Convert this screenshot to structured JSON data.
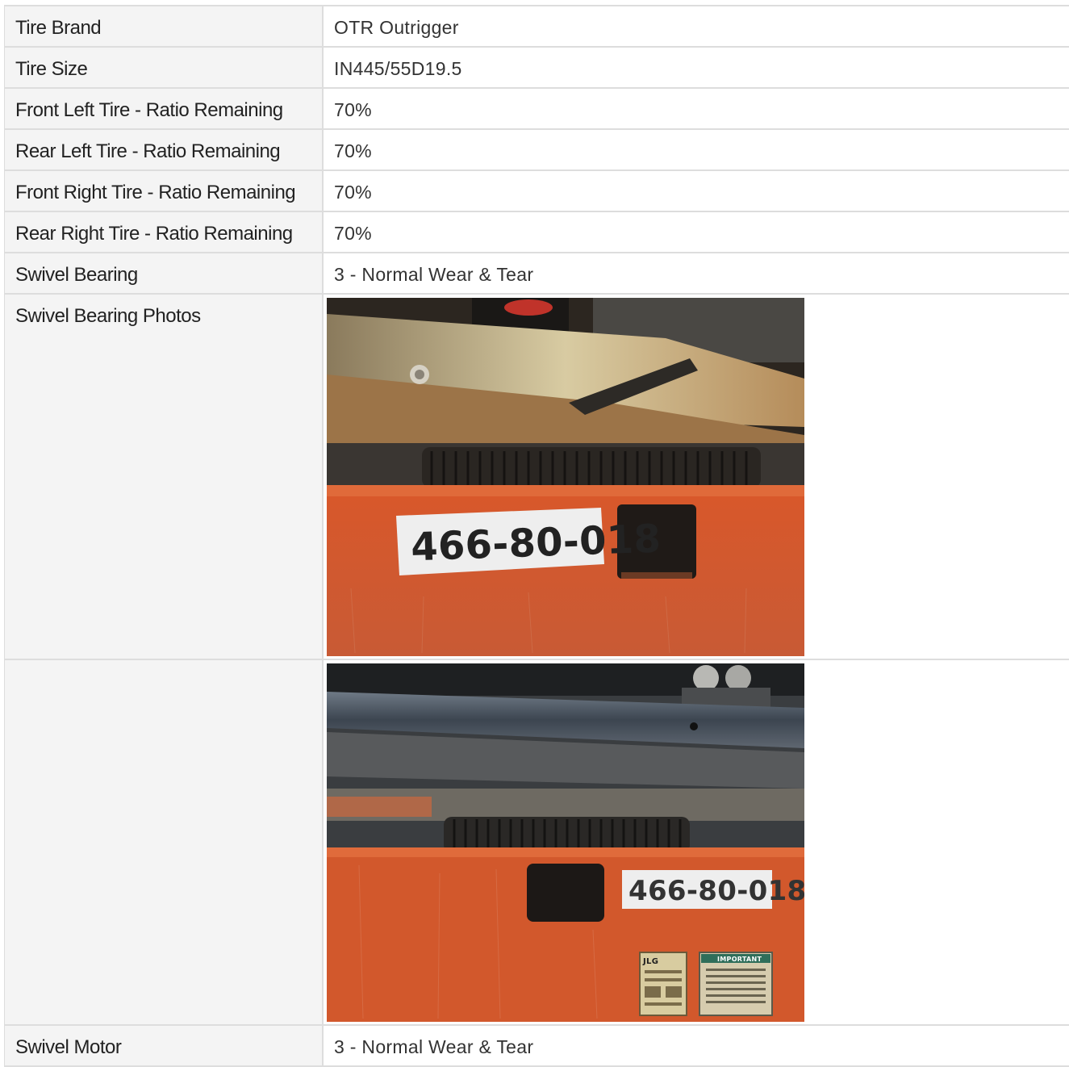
{
  "rows": [
    {
      "label": "Tire Brand",
      "value": "OTR Outrigger"
    },
    {
      "label": "Tire Size",
      "value": "IN445/55D19.5"
    },
    {
      "label": "Front Left Tire - Ratio Remaining",
      "value": "70%"
    },
    {
      "label": "Rear Left Tire - Ratio Remaining",
      "value": "70%"
    },
    {
      "label": "Front Right Tire - Ratio Remaining",
      "value": "70%"
    },
    {
      "label": "Rear Right Tire - Ratio Remaining",
      "value": "70%"
    },
    {
      "label": "Swivel Bearing",
      "value": "3 - Normal Wear & Tear"
    }
  ],
  "photos": {
    "label": "Swivel Bearing Photos",
    "photo1_decal": "466-80-018",
    "photo2_decal": "466-80-018",
    "photo2_sticker_brand": "JLG",
    "photo2_sticker_warning": "IMPORTANT"
  },
  "last_row": {
    "label": "Swivel Motor",
    "value": "3 - Normal Wear & Tear"
  }
}
